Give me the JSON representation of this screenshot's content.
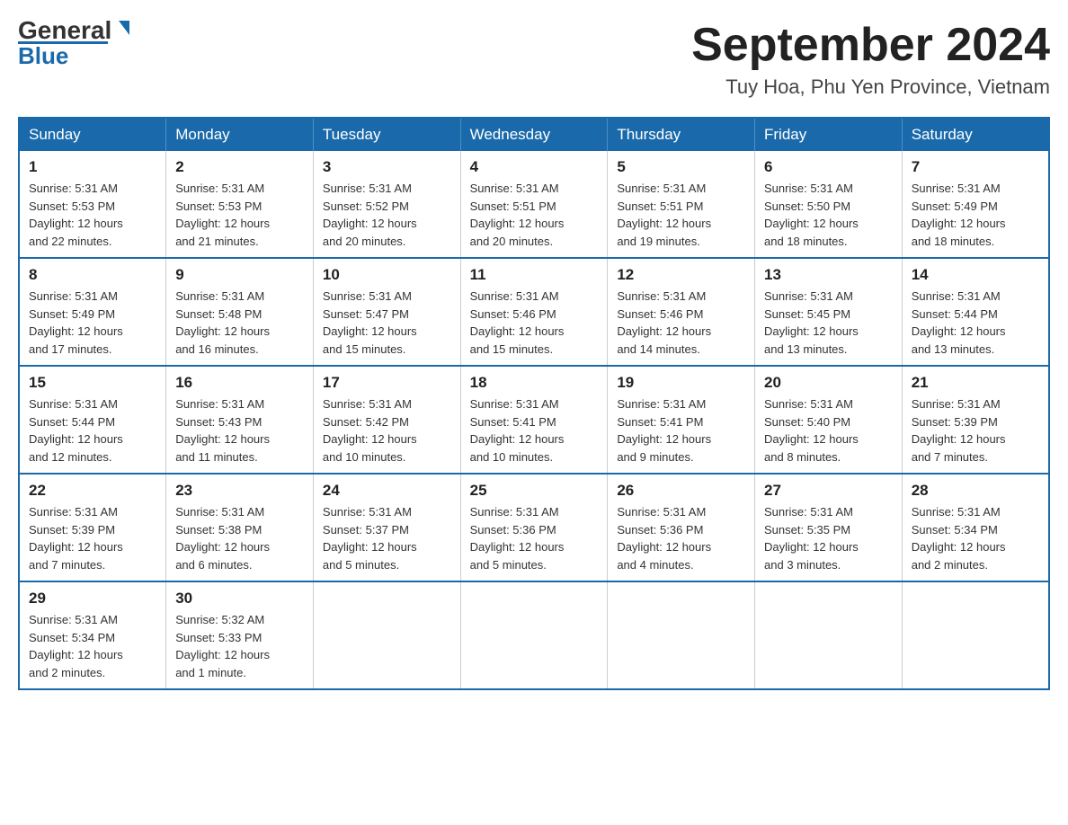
{
  "header": {
    "logo_general": "General",
    "logo_blue": "Blue",
    "month_title": "September 2024",
    "location": "Tuy Hoa, Phu Yen Province, Vietnam"
  },
  "days_of_week": [
    "Sunday",
    "Monday",
    "Tuesday",
    "Wednesday",
    "Thursday",
    "Friday",
    "Saturday"
  ],
  "weeks": [
    [
      {
        "day": "1",
        "sunrise": "5:31 AM",
        "sunset": "5:53 PM",
        "daylight": "12 hours and 22 minutes."
      },
      {
        "day": "2",
        "sunrise": "5:31 AM",
        "sunset": "5:53 PM",
        "daylight": "12 hours and 21 minutes."
      },
      {
        "day": "3",
        "sunrise": "5:31 AM",
        "sunset": "5:52 PM",
        "daylight": "12 hours and 20 minutes."
      },
      {
        "day": "4",
        "sunrise": "5:31 AM",
        "sunset": "5:51 PM",
        "daylight": "12 hours and 20 minutes."
      },
      {
        "day": "5",
        "sunrise": "5:31 AM",
        "sunset": "5:51 PM",
        "daylight": "12 hours and 19 minutes."
      },
      {
        "day": "6",
        "sunrise": "5:31 AM",
        "sunset": "5:50 PM",
        "daylight": "12 hours and 18 minutes."
      },
      {
        "day": "7",
        "sunrise": "5:31 AM",
        "sunset": "5:49 PM",
        "daylight": "12 hours and 18 minutes."
      }
    ],
    [
      {
        "day": "8",
        "sunrise": "5:31 AM",
        "sunset": "5:49 PM",
        "daylight": "12 hours and 17 minutes."
      },
      {
        "day": "9",
        "sunrise": "5:31 AM",
        "sunset": "5:48 PM",
        "daylight": "12 hours and 16 minutes."
      },
      {
        "day": "10",
        "sunrise": "5:31 AM",
        "sunset": "5:47 PM",
        "daylight": "12 hours and 15 minutes."
      },
      {
        "day": "11",
        "sunrise": "5:31 AM",
        "sunset": "5:46 PM",
        "daylight": "12 hours and 15 minutes."
      },
      {
        "day": "12",
        "sunrise": "5:31 AM",
        "sunset": "5:46 PM",
        "daylight": "12 hours and 14 minutes."
      },
      {
        "day": "13",
        "sunrise": "5:31 AM",
        "sunset": "5:45 PM",
        "daylight": "12 hours and 13 minutes."
      },
      {
        "day": "14",
        "sunrise": "5:31 AM",
        "sunset": "5:44 PM",
        "daylight": "12 hours and 13 minutes."
      }
    ],
    [
      {
        "day": "15",
        "sunrise": "5:31 AM",
        "sunset": "5:44 PM",
        "daylight": "12 hours and 12 minutes."
      },
      {
        "day": "16",
        "sunrise": "5:31 AM",
        "sunset": "5:43 PM",
        "daylight": "12 hours and 11 minutes."
      },
      {
        "day": "17",
        "sunrise": "5:31 AM",
        "sunset": "5:42 PM",
        "daylight": "12 hours and 10 minutes."
      },
      {
        "day": "18",
        "sunrise": "5:31 AM",
        "sunset": "5:41 PM",
        "daylight": "12 hours and 10 minutes."
      },
      {
        "day": "19",
        "sunrise": "5:31 AM",
        "sunset": "5:41 PM",
        "daylight": "12 hours and 9 minutes."
      },
      {
        "day": "20",
        "sunrise": "5:31 AM",
        "sunset": "5:40 PM",
        "daylight": "12 hours and 8 minutes."
      },
      {
        "day": "21",
        "sunrise": "5:31 AM",
        "sunset": "5:39 PM",
        "daylight": "12 hours and 7 minutes."
      }
    ],
    [
      {
        "day": "22",
        "sunrise": "5:31 AM",
        "sunset": "5:39 PM",
        "daylight": "12 hours and 7 minutes."
      },
      {
        "day": "23",
        "sunrise": "5:31 AM",
        "sunset": "5:38 PM",
        "daylight": "12 hours and 6 minutes."
      },
      {
        "day": "24",
        "sunrise": "5:31 AM",
        "sunset": "5:37 PM",
        "daylight": "12 hours and 5 minutes."
      },
      {
        "day": "25",
        "sunrise": "5:31 AM",
        "sunset": "5:36 PM",
        "daylight": "12 hours and 5 minutes."
      },
      {
        "day": "26",
        "sunrise": "5:31 AM",
        "sunset": "5:36 PM",
        "daylight": "12 hours and 4 minutes."
      },
      {
        "day": "27",
        "sunrise": "5:31 AM",
        "sunset": "5:35 PM",
        "daylight": "12 hours and 3 minutes."
      },
      {
        "day": "28",
        "sunrise": "5:31 AM",
        "sunset": "5:34 PM",
        "daylight": "12 hours and 2 minutes."
      }
    ],
    [
      {
        "day": "29",
        "sunrise": "5:31 AM",
        "sunset": "5:34 PM",
        "daylight": "12 hours and 2 minutes."
      },
      {
        "day": "30",
        "sunrise": "5:32 AM",
        "sunset": "5:33 PM",
        "daylight": "12 hours and 1 minute."
      },
      null,
      null,
      null,
      null,
      null
    ]
  ],
  "labels": {
    "sunrise": "Sunrise:",
    "sunset": "Sunset:",
    "daylight": "Daylight:"
  }
}
